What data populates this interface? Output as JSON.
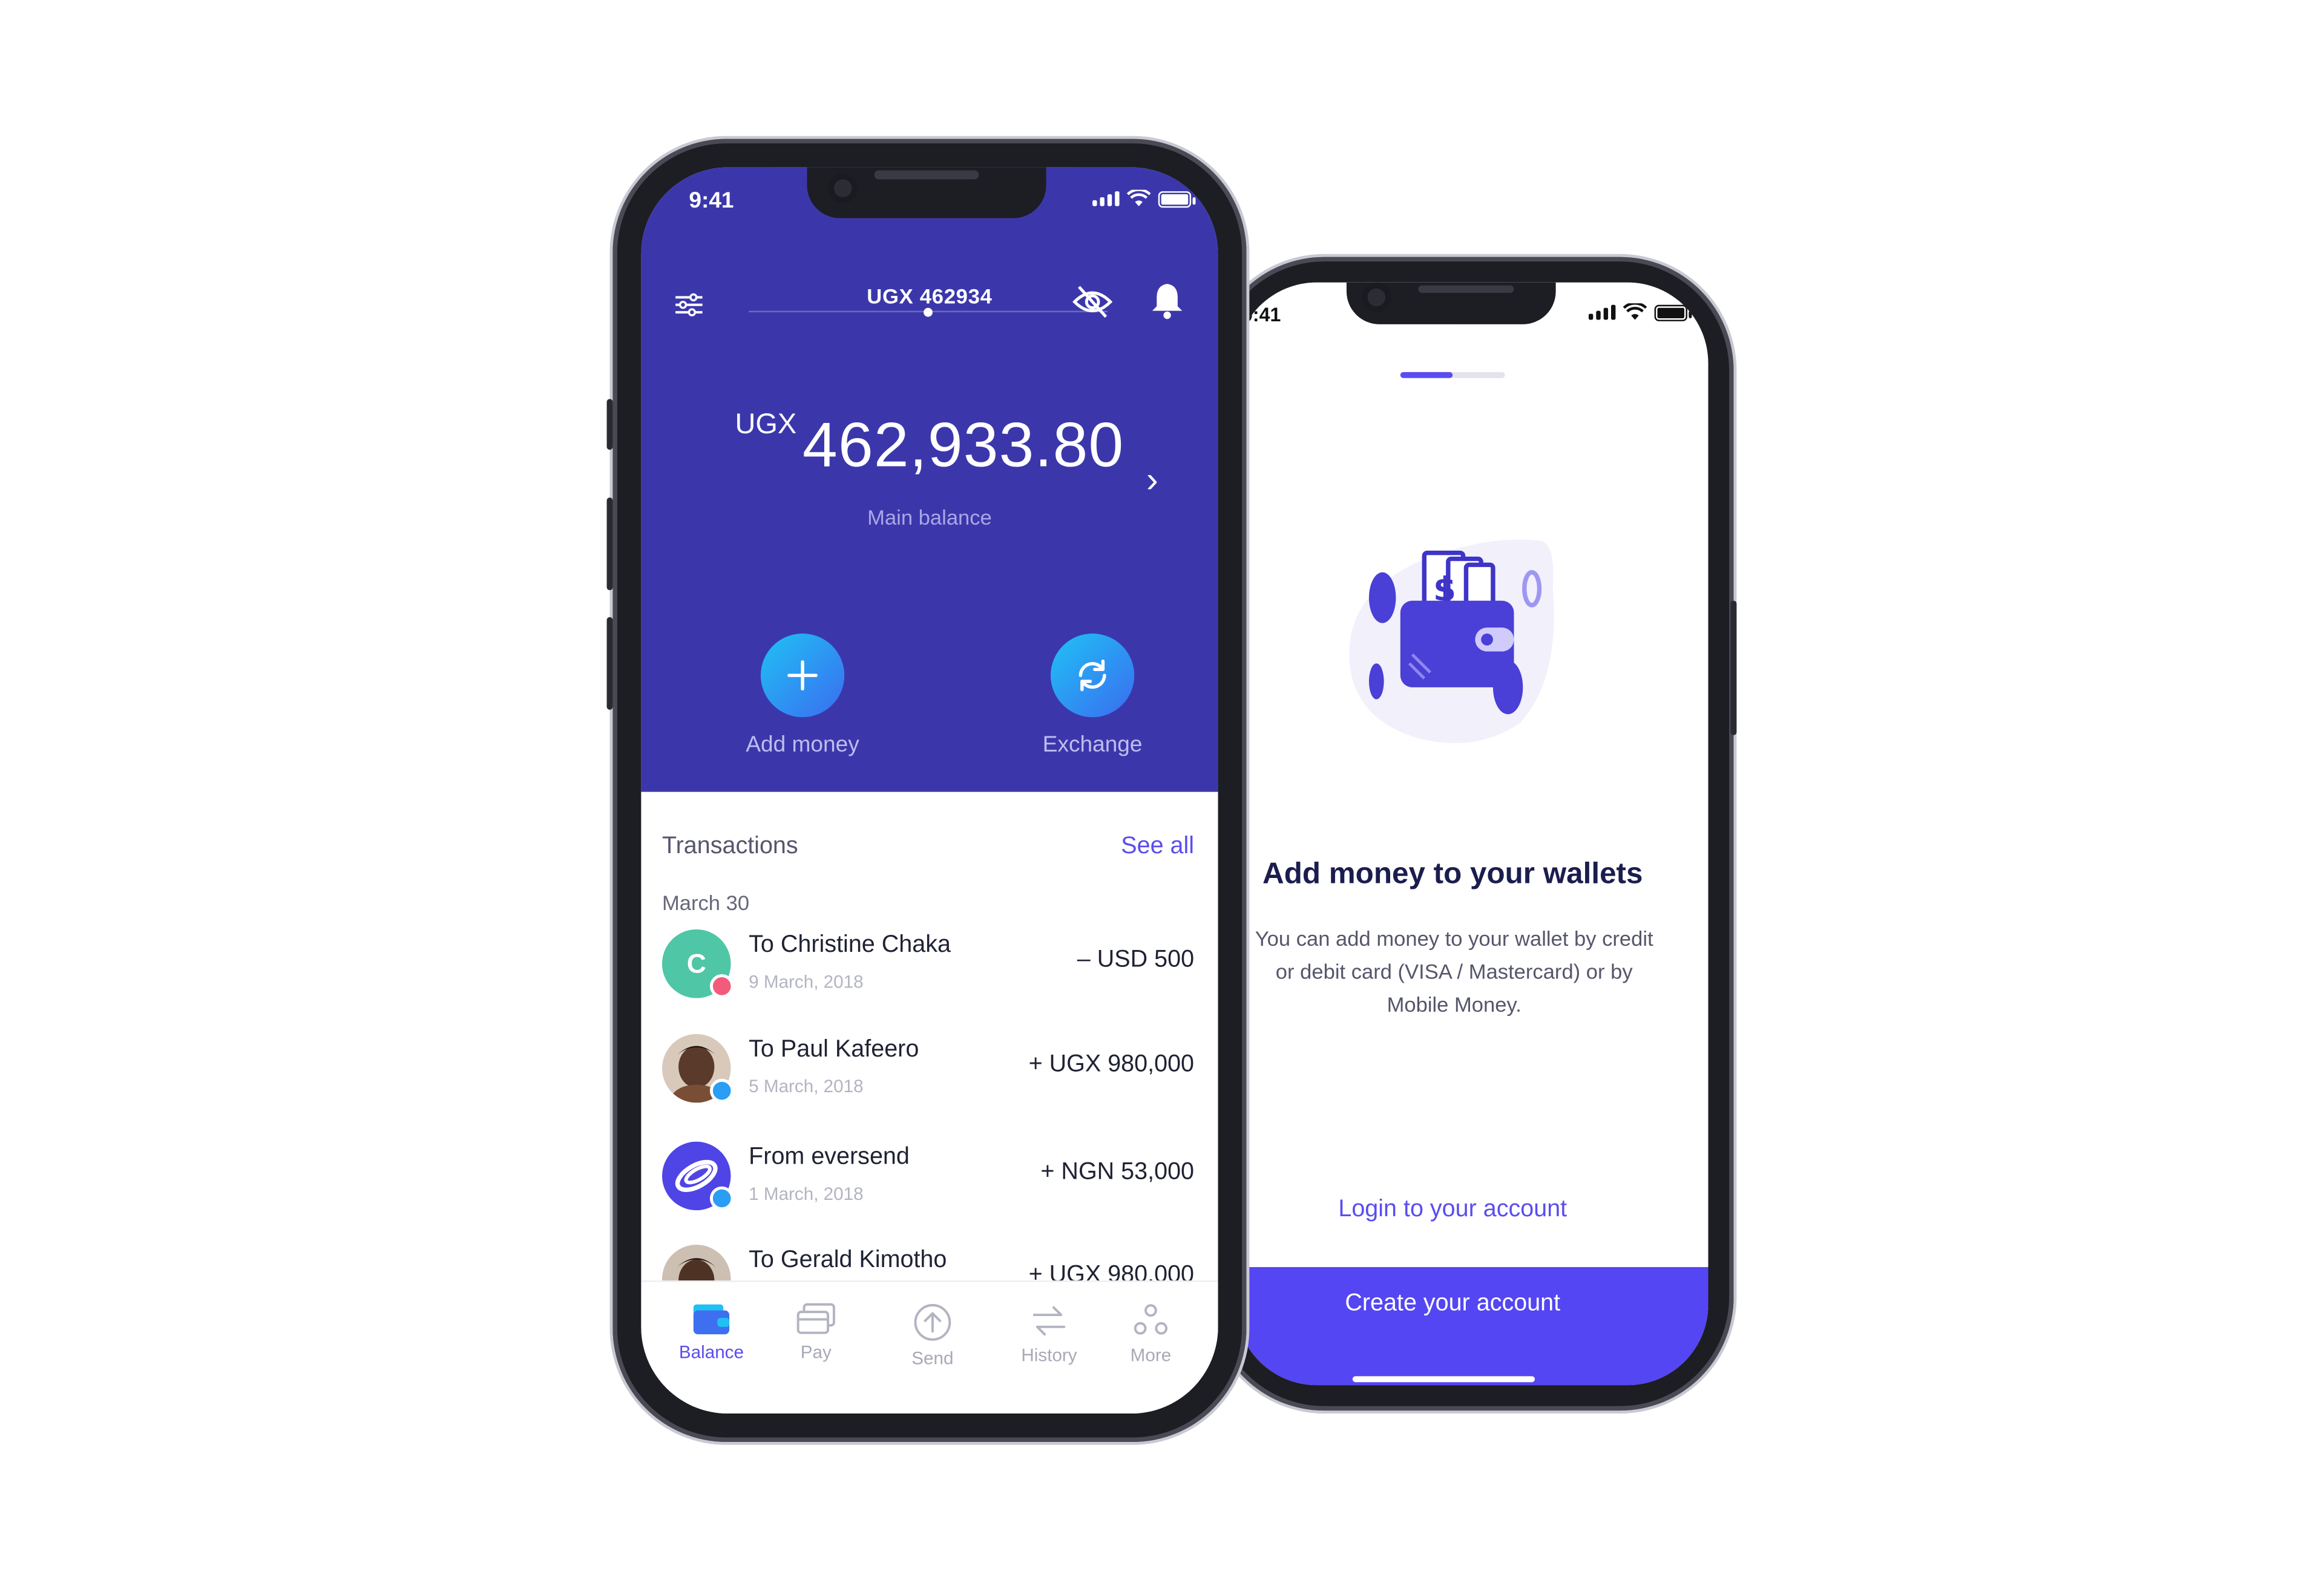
{
  "colors": {
    "hero_bg": "#3b37ab",
    "accent": "#5a4df0",
    "button_bg": "#5446f2",
    "action_gradient_start": "#1fc2f5",
    "action_gradient_end": "#3b6cf0"
  },
  "main_phone": {
    "status_time": "9:41",
    "header": {
      "account_label": "UGX 462934",
      "icons": [
        "sliders-icon",
        "eye-off-icon",
        "bell-icon"
      ]
    },
    "balance": {
      "currency": "UGX",
      "amount": "462,933.80",
      "label": "Main balance"
    },
    "actions": [
      {
        "label": "Add money",
        "icon": "plus-icon"
      },
      {
        "label": "Exchange",
        "icon": "exchange-icon"
      }
    ],
    "transactions": {
      "title": "Transactions",
      "see_all": "See all",
      "date_group": "March 30",
      "items": [
        {
          "name": "To Christine Chaka",
          "date": "9 March, 2018",
          "amount": "– USD 500",
          "avatar_initial": "C",
          "badge_color": "#f25b7a"
        },
        {
          "name": "To Paul Kafeero",
          "date": "5 March, 2018",
          "amount": "+ UGX 980,000",
          "avatar_initial": "",
          "badge_color": "#2a9df4"
        },
        {
          "name": "From eversend",
          "date": "1 March, 2018",
          "amount": "+ NGN 53,000",
          "avatar_initial": "",
          "badge_color": "#2a9df4"
        },
        {
          "name": "To Gerald Kimotho",
          "date": "",
          "amount": "+ UGX 980,000",
          "avatar_initial": "",
          "badge_color": ""
        }
      ]
    },
    "tabs": [
      {
        "label": "Balance",
        "icon": "wallet-icon",
        "active": true
      },
      {
        "label": "Pay",
        "icon": "card-icon",
        "active": false
      },
      {
        "label": "Send",
        "icon": "upload-icon",
        "active": false
      },
      {
        "label": "History",
        "icon": "history-icon",
        "active": false
      },
      {
        "label": "More",
        "icon": "more-icon",
        "active": false
      }
    ]
  },
  "side_phone": {
    "status_time": "9:41",
    "onboarding_progress": 0.5,
    "title": "Add money to your wallets",
    "description": "You can add money to your wallet by credit or debit card (VISA / Mastercard) or by Mobile Money.",
    "login_link": "Login to your account",
    "create_button": "Create your account",
    "illustration": "wallet-illustration"
  }
}
